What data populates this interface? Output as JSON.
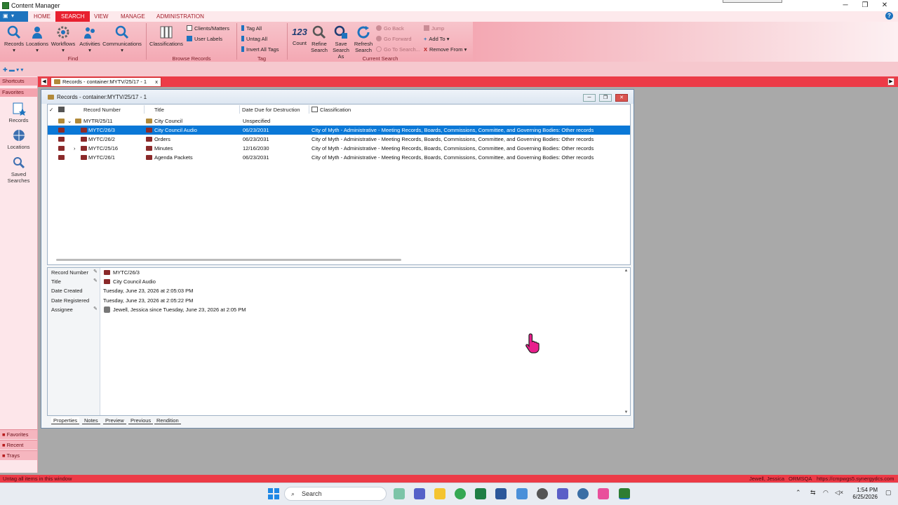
{
  "window": {
    "title": "Content Manager"
  },
  "ribbon_tabs": [
    "HOME",
    "SEARCH",
    "VIEW",
    "MANAGE",
    "ADMINISTRATION"
  ],
  "ribbon": {
    "find": {
      "label": "Find",
      "buttons": [
        "Records",
        "Locations",
        "Workflows",
        "Activities",
        "Communications"
      ]
    },
    "browse": {
      "label": "Browse Records",
      "classifications": "Classifications",
      "clients_matters": "Clients/Matters",
      "user_labels": "User Labels"
    },
    "tag": {
      "label": "Tag",
      "tag_all": "Tag All",
      "untag_all": "Untag All",
      "invert_all_tags": "Invert All Tags"
    },
    "current_search": {
      "label": "Current Search",
      "count_icon": "123",
      "count": "Count",
      "refine": "Refine Search",
      "save": "Save Search As",
      "refresh": "Refresh Search",
      "go_back": "Go Back",
      "go_forward": "Go Forward",
      "go_to_search": "Go To Search...",
      "jump": "Jump",
      "add_to": "Add To",
      "remove_from": "Remove From"
    }
  },
  "doc_tab": {
    "label": "Records - container:MYTV/25/17 - 1",
    "close": "x"
  },
  "sidebar": {
    "shortcuts": "Shortcuts",
    "favorites_head": "Favorites",
    "items": [
      {
        "label": "Records"
      },
      {
        "label": "Locations"
      },
      {
        "label": "Saved Searches"
      }
    ],
    "footer": [
      "Favorites",
      "Recent",
      "Trays"
    ]
  },
  "records_window": {
    "title": "Records - container:MYTV/25/17 - 1",
    "columns": [
      "Record Number",
      "Title",
      "Date Due for Destruction",
      "Classification"
    ],
    "rows": [
      {
        "number": "MYTR/25/11",
        "title": "City Council",
        "due": "Unspecified",
        "classification": ""
      },
      {
        "number": "MYTC/26/3",
        "title": "City Council Audio",
        "due": "06/23/2031",
        "classification": "City of Myth - Administrative - Meeting Records, Boards, Commissions, Committee, and Governing Bodies: Other records"
      },
      {
        "number": "MYTC/26/2",
        "title": "Orders",
        "due": "06/23/2031",
        "classification": "City of Myth - Administrative - Meeting Records, Boards, Commissions, Committee, and Governing Bodies: Other records"
      },
      {
        "number": "MYTC/25/16",
        "title": "Minutes",
        "due": "12/16/2030",
        "classification": "City of Myth - Administrative - Meeting Records, Boards, Commissions, Committee, and Governing Bodies: Other records"
      },
      {
        "number": "MYTC/26/1",
        "title": "Agenda Packets",
        "due": "06/23/2031",
        "classification": "City of Myth - Administrative - Meeting Records, Boards, Commissions, Committee, and Governing Bodies: Other records"
      }
    ]
  },
  "properties": {
    "fields": [
      {
        "label": "Record Number",
        "value": "MYTC/26/3"
      },
      {
        "label": "Title",
        "value": "City Council Audio"
      },
      {
        "label": "Date Created",
        "value": "Tuesday, June 23, 2026 at 2:05:03 PM"
      },
      {
        "label": "Date Registered",
        "value": "Tuesday, June 23, 2026 at 2:05:22 PM"
      },
      {
        "label": "Assignee",
        "value": "Jewell, Jessica since Tuesday, June 23, 2026 at 2:05 PM"
      }
    ],
    "tabs": [
      "Properties",
      "Notes",
      "Preview",
      "Previous",
      "Rendition"
    ]
  },
  "status": {
    "left": "Untag all items in this window",
    "user": "Jewell, Jessica",
    "db": "ORMSQA",
    "url": "https://cmpwgs5.synergydcs.com"
  },
  "taskbar": {
    "search": "Search",
    "time": "1:54 PM",
    "date": "6/25/2026"
  },
  "colors": {
    "accent": "#e8202f",
    "ribbon": "#f4a8b3",
    "selection": "#0a78d7"
  }
}
